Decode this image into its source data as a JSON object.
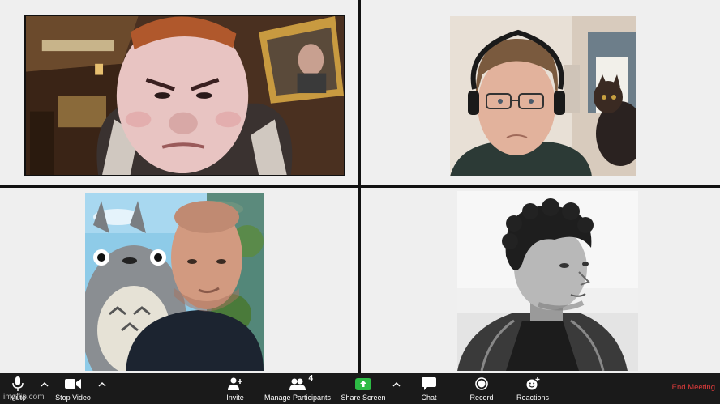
{
  "toolbar": {
    "mute_label": "Mute",
    "stop_video_label": "Stop Video",
    "invite_label": "Invite",
    "manage_participants_label": "Manage Participants",
    "participant_count": "4",
    "share_screen_label": "Share Screen",
    "chat_label": "Chat",
    "record_label": "Record",
    "reactions_label": "Reactions",
    "end_meeting_label": "End Meeting"
  },
  "watermark": "imgflip.com",
  "colors": {
    "toolbar_bg": "#1a1a1a",
    "share_green": "#2dbb45",
    "end_red": "#e23c3c",
    "grid_bg": "#efefef",
    "divider": "#111111"
  },
  "icons": {
    "mute": "microphone-icon",
    "stop_video": "video-camera-icon",
    "invite": "add-person-icon",
    "manage_participants": "participants-icon",
    "share_screen": "share-screen-icon",
    "chat": "chat-bubble-icon",
    "record": "record-icon",
    "reactions": "smiley-add-icon"
  }
}
